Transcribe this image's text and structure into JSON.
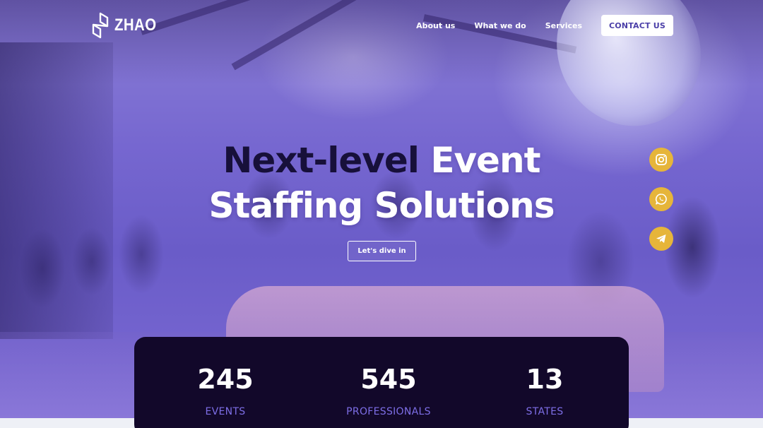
{
  "brand": {
    "name": "ZHAO"
  },
  "nav": {
    "links": [
      "About us",
      "What we do",
      "Services"
    ],
    "contact_label": "CONTACT US"
  },
  "hero": {
    "headline_part1": "Next-level",
    "headline_part2": "Event",
    "headline_line2": "Staffing Solutions",
    "cta_label": "Let's dive in"
  },
  "social": {
    "items": [
      "instagram-icon",
      "whatsapp-icon",
      "telegram-icon"
    ],
    "color": "#e6b53a"
  },
  "stats": [
    {
      "value": "245",
      "label": "EVENTS"
    },
    {
      "value": "545",
      "label": "PROFESSIONALS"
    },
    {
      "value": "13",
      "label": "STATES"
    }
  ],
  "colors": {
    "accent": "#7d6ee6",
    "panel": "#12082a",
    "headline_dark": "#17103a",
    "contact_text": "#4b3fa8"
  }
}
